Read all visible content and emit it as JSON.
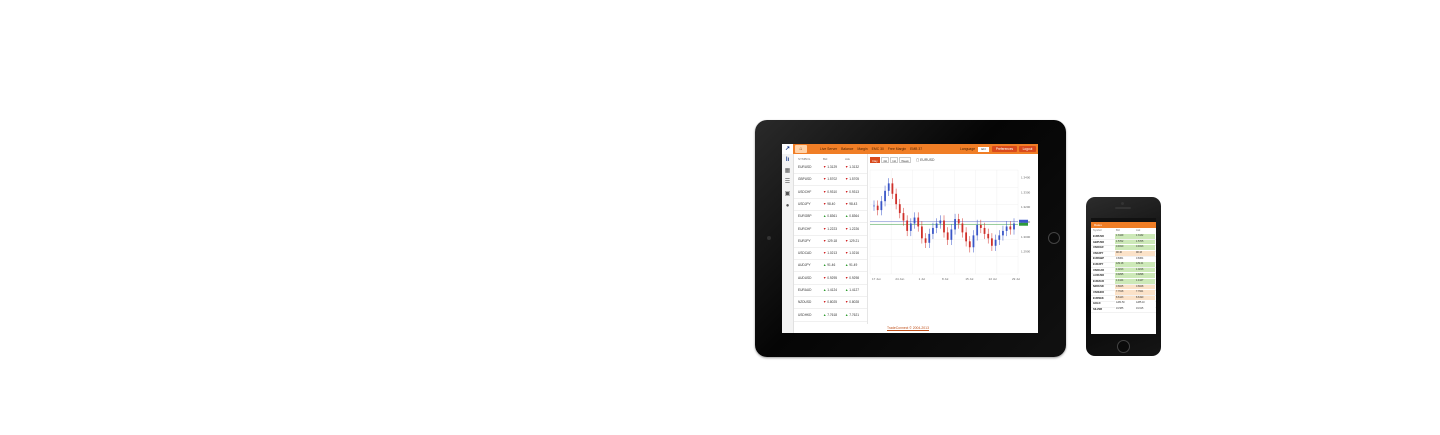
{
  "colors": {
    "accent": "#f07e26",
    "button": "#d94a1c",
    "down": "#d01e1e",
    "up": "#2a9a2a",
    "candle_up": "#3a56c8",
    "candle_down": "#d0302a"
  },
  "tablet": {
    "topbar": {
      "logo_icon": "trade-logo-icon",
      "home_icon": "home-icon",
      "info_items": [
        "Live Server",
        "Balance",
        "Margin",
        "EMC 30",
        "Free Margin",
        "EMB 37"
      ],
      "language_label": "Language",
      "language_value": "EN",
      "preferences_button": "Preferences",
      "logout_button": "Logout"
    },
    "side_icons": [
      "chart-logo-icon",
      "grid-icon",
      "list-icon",
      "briefcase-icon",
      "user-icon"
    ],
    "quotes": {
      "columns": [
        "SYMBOL",
        "Bid",
        "Ask"
      ],
      "rows": [
        {
          "symbol": "EURUSD",
          "bid": "1.3129",
          "ask": "1.3132",
          "dir": "down"
        },
        {
          "symbol": "GBPUSD",
          "bid": "1.5702",
          "ask": "1.5705",
          "dir": "down"
        },
        {
          "symbol": "USDCHF",
          "bid": "0.9310",
          "ask": "0.9313",
          "dir": "down"
        },
        {
          "symbol": "USDJPY",
          "bid": "98.40",
          "ask": "98.43",
          "dir": "down"
        },
        {
          "symbol": "EURGBP",
          "bid": "0.8361",
          "ask": "0.8364",
          "dir": "up"
        },
        {
          "symbol": "EURCHF",
          "bid": "1.2223",
          "ask": "1.2226",
          "dir": "down"
        },
        {
          "symbol": "EURJPY",
          "bid": "129.18",
          "ask": "129.21",
          "dir": "down"
        },
        {
          "symbol": "USDCAD",
          "bid": "1.0213",
          "ask": "1.0216",
          "dir": "down"
        },
        {
          "symbol": "AUDJPY",
          "bid": "91.46",
          "ask": "91.49",
          "dir": "up"
        },
        {
          "symbol": "AUDUSD",
          "bid": "0.9295",
          "ask": "0.9298",
          "dir": "down"
        },
        {
          "symbol": "EURAUD",
          "bid": "1.4124",
          "ask": "1.4127",
          "dir": "up"
        },
        {
          "symbol": "NZDUSD",
          "bid": "0.8025",
          "ask": "0.8028",
          "dir": "down"
        },
        {
          "symbol": "USDHKD",
          "bid": "7.7618",
          "ask": "7.7621",
          "dir": "up"
        }
      ]
    },
    "chart_toolbar": {
      "timeframes": [
        "Day",
        "4H",
        "1H",
        "Week"
      ],
      "active": "Day",
      "pair": "EURUSD"
    },
    "footer": "TradeConnect © 2004-2013"
  },
  "chart_data": {
    "type": "line",
    "pair": "EURUSD",
    "title": "",
    "xlabel": "",
    "ylabel": "",
    "x": [
      "17 Jun",
      "24 Jun",
      "1 Jul",
      "8 Jul",
      "15 Jul",
      "22 Jul",
      "29 Jul"
    ],
    "ylim": [
      1.275,
      1.345
    ],
    "yticks": [
      "1.3400",
      "1.3300",
      "1.3200",
      "1.3100",
      "1.3000",
      "1.2900"
    ],
    "series": [
      {
        "values": [
          1.321,
          1.318,
          1.324,
          1.331,
          1.336,
          1.329,
          1.322,
          1.316,
          1.311,
          1.304,
          1.309,
          1.313,
          1.307,
          1.299,
          1.296,
          1.302,
          1.306,
          1.309,
          1.311,
          1.303,
          1.298,
          1.305,
          1.312,
          1.309,
          1.303,
          1.297,
          1.293,
          1.301,
          1.308,
          1.306,
          1.302,
          1.299,
          1.294,
          1.298,
          1.301,
          1.304,
          1.307,
          1.305,
          1.309
        ]
      }
    ],
    "horizontal_lines": [
      1.3085,
      1.3105
    ],
    "grid": true,
    "legend": "none"
  },
  "phone": {
    "title": "Rates",
    "columns": [
      "Symbol",
      "Bid",
      "Ask"
    ],
    "rows": [
      {
        "symbol": "EURUSD",
        "bid": "1.3129",
        "ask": "1.3132",
        "bid_color": "#cde9b8",
        "ask_color": "#cde9b8"
      },
      {
        "symbol": "GBPUSD",
        "bid": "1.5702",
        "ask": "1.5705",
        "bid_color": "#cde9b8",
        "ask_color": "#cde9b8"
      },
      {
        "symbol": "USDCHF",
        "bid": "0.9310",
        "ask": "0.9313",
        "bid_color": "#cde9b8",
        "ask_color": "#cde9b8"
      },
      {
        "symbol": "USDJPY",
        "bid": "98.40",
        "ask": "98.43",
        "bid_color": "#fbe2c8",
        "ask_color": "#fbe2c8"
      },
      {
        "symbol": "EURGBP",
        "bid": "0.8361",
        "ask": "0.8364",
        "bid_color": "#ffffff",
        "ask_color": "#ffffff"
      },
      {
        "symbol": "EURJPY",
        "bid": "129.18",
        "ask": "129.21",
        "bid_color": "#cde9b8",
        "ask_color": "#cde9b8"
      },
      {
        "symbol": "USDCAD",
        "bid": "1.0213",
        "ask": "1.0216",
        "bid_color": "#cde9b8",
        "ask_color": "#cde9b8"
      },
      {
        "symbol": "AUDUSD",
        "bid": "0.9295",
        "ask": "0.9298",
        "bid_color": "#cde9b8",
        "ask_color": "#cde9b8"
      },
      {
        "symbol": "EURAUD",
        "bid": "1.4124",
        "ask": "1.4127",
        "bid_color": "#cde9b8",
        "ask_color": "#cde9b8"
      },
      {
        "symbol": "NZDUSD",
        "bid": "0.8025",
        "ask": "0.8028",
        "bid_color": "#fbe2c8",
        "ask_color": "#fbe2c8"
      },
      {
        "symbol": "USDHKD",
        "bid": "7.7618",
        "ask": "7.7621",
        "bid_color": "#fbe2c8",
        "ask_color": "#fbe2c8"
      },
      {
        "symbol": "EURSEK",
        "bid": "8.6123",
        "ask": "8.6190",
        "bid_color": "#fbe2c8",
        "ask_color": "#fbe2c8"
      },
      {
        "symbol": "GOLD",
        "bid": "1284.50",
        "ask": "1285.10",
        "bid_color": "#ffffff",
        "ask_color": "#ffffff"
      },
      {
        "symbol": "SILVER",
        "bid": "19.585",
        "ask": "19.615",
        "bid_color": "#ffffff",
        "ask_color": "#ffffff"
      }
    ]
  }
}
